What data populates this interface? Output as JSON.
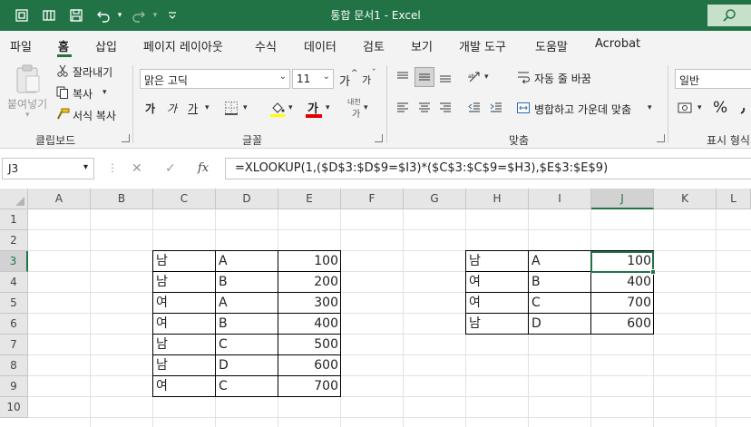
{
  "window": {
    "title": "통합 문서1  -  Excel",
    "accent": "#217346"
  },
  "qat": {
    "icons": [
      "autosave-icon",
      "touch-mode-icon",
      "save-icon",
      "undo-icon",
      "redo-icon",
      "customize-icon"
    ]
  },
  "menu": {
    "tabs": [
      "파일",
      "홈",
      "삽입",
      "페이지 레이아웃",
      "수식",
      "데이터",
      "검토",
      "보기",
      "개발 도구",
      "도움말",
      "Acrobat"
    ],
    "active_tab": "홈"
  },
  "ribbon": {
    "clipboard": {
      "paste": "붙여넣기",
      "cut": "잘라내기",
      "copy": "복사",
      "format_painter": "서식 복사",
      "label": "클립보드"
    },
    "font": {
      "family": "맑은 고딕",
      "size": "11",
      "grow": "가",
      "shrink": "가",
      "bold": "가",
      "italic": "가",
      "underline": "가",
      "font_color": "가",
      "phonetic_top": "내천",
      "phonetic_bottom": "가",
      "label": "글꼴"
    },
    "alignment": {
      "wrap_text": "자동 줄 바꿈",
      "merge_center": "병합하고 가운데 맞춤",
      "label": "맞춤"
    },
    "number": {
      "format": "일반",
      "percent": "%",
      "label": "표시 형식"
    }
  },
  "formula_bar": {
    "name_box": "J3",
    "formula": "=XLOOKUP(1,($D$3:$D$9=$I3)*($C$3:$C$9=$H3),$E$3:$E$9)",
    "fx": "fx"
  },
  "sheet": {
    "columns": [
      "A",
      "B",
      "C",
      "D",
      "E",
      "F",
      "G",
      "H",
      "I",
      "J",
      "K",
      "L"
    ],
    "rows": [
      "1",
      "2",
      "3",
      "4",
      "5",
      "6",
      "7",
      "8",
      "9",
      "10"
    ],
    "selected_column": "J",
    "selected_row": "3",
    "source_table": [
      [
        "남",
        "A",
        "100"
      ],
      [
        "남",
        "B",
        "200"
      ],
      [
        "여",
        "A",
        "300"
      ],
      [
        "여",
        "B",
        "400"
      ],
      [
        "남",
        "C",
        "500"
      ],
      [
        "남",
        "D",
        "600"
      ],
      [
        "여",
        "C",
        "700"
      ]
    ],
    "lookup_table": [
      [
        "남",
        "A",
        "100"
      ],
      [
        "여",
        "B",
        "400"
      ],
      [
        "여",
        "C",
        "700"
      ],
      [
        "남",
        "D",
        "600"
      ]
    ]
  }
}
